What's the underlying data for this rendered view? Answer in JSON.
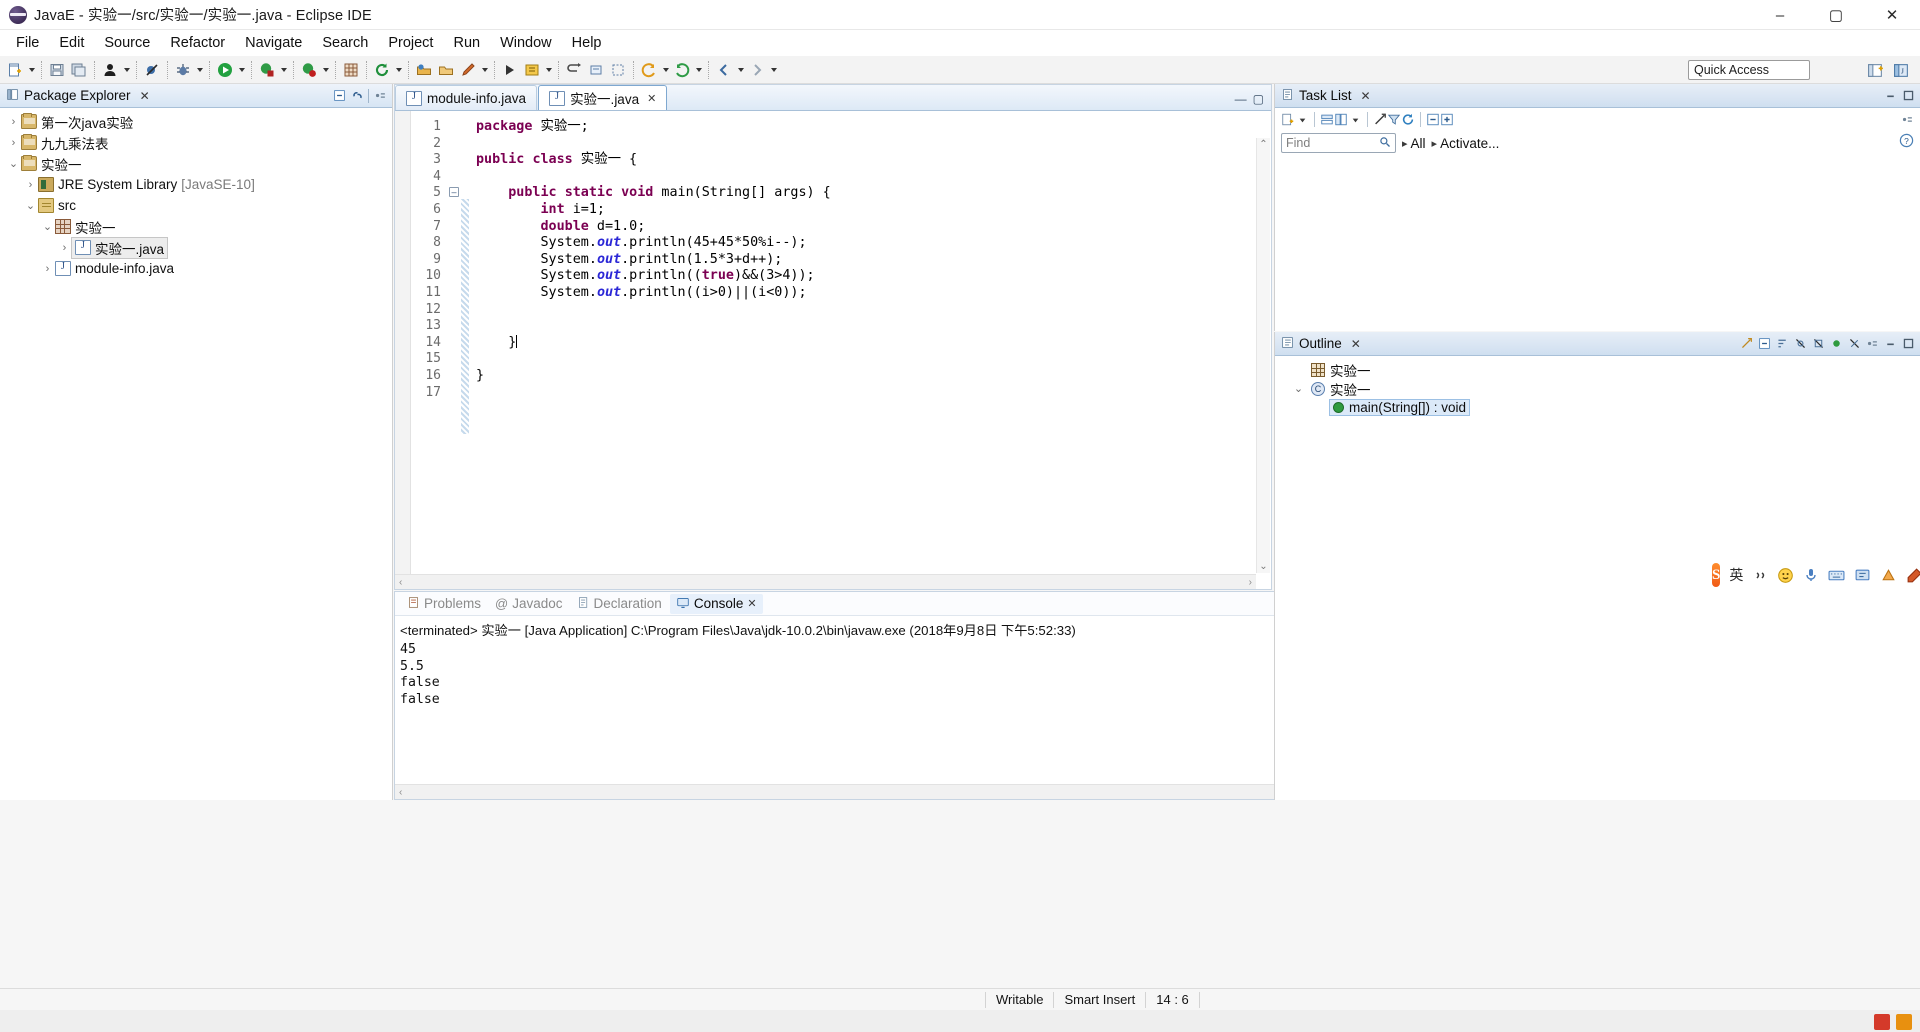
{
  "window": {
    "title": "JavaE - 实验一/src/实验一/实验一.java - Eclipse IDE",
    "app_icon": "eclipse-icon",
    "minimize": "–",
    "maximize": "▢",
    "close": "✕"
  },
  "menu": {
    "items": [
      {
        "label": "File"
      },
      {
        "label": "Edit"
      },
      {
        "label": "Source"
      },
      {
        "label": "Refactor"
      },
      {
        "label": "Navigate"
      },
      {
        "label": "Search"
      },
      {
        "label": "Project"
      },
      {
        "label": "Run"
      },
      {
        "label": "Window"
      },
      {
        "label": "Help"
      }
    ]
  },
  "toolbar": {
    "quick_access": "Quick Access",
    "buttons": [
      "new-button",
      "save-button",
      "save-all-button",
      "person-button",
      "skip-breakpoints-button",
      "debug-button",
      "run-button",
      "run-external-tools-button",
      "run-config-button",
      "new-package-button",
      "refresh-button",
      "open-type-button",
      "open-resource-button",
      "search-button",
      "last-edit-button",
      "back-button",
      "forward-button"
    ],
    "perspective_buttons": [
      "open-perspective-button",
      "java-perspective-button"
    ]
  },
  "package_explorer": {
    "title": "Package Explorer",
    "close_glyph": "✕",
    "tools": [
      "collapse-all-icon",
      "link-with-editor-icon",
      "view-menu-icon"
    ],
    "tree": [
      {
        "indent": 0,
        "twisty": "›",
        "icon": "project-icon",
        "label": "第一次java实验",
        "selected": false
      },
      {
        "indent": 0,
        "twisty": "›",
        "icon": "project-icon",
        "label": "九九乘法表",
        "selected": false
      },
      {
        "indent": 0,
        "twisty": "⌄",
        "icon": "project-icon",
        "label": "实验一",
        "selected": false
      },
      {
        "indent": 1,
        "twisty": "›",
        "icon": "library-icon",
        "label": "JRE System Library",
        "suffix": "[JavaSE-10]",
        "selected": false
      },
      {
        "indent": 1,
        "twisty": "⌄",
        "icon": "source-folder-icon",
        "label": "src",
        "selected": false
      },
      {
        "indent": 2,
        "twisty": "⌄",
        "icon": "package-icon",
        "label": "实验一",
        "selected": false
      },
      {
        "indent": 3,
        "twisty": "›",
        "icon": "java-file-icon",
        "label": "实验一.java",
        "selected": true
      },
      {
        "indent": 2,
        "twisty": "›",
        "icon": "java-file-icon",
        "label": "module-info.java",
        "selected": false
      }
    ]
  },
  "editor": {
    "tabs": [
      {
        "label": "module-info.java",
        "icon": "java-file-icon",
        "active": false,
        "closable": false
      },
      {
        "label": "实验一.java",
        "icon": "java-file-icon",
        "active": true,
        "closable": true,
        "close_glyph": "✕"
      }
    ],
    "minimize_glyph": "—",
    "maximize_glyph": "▢",
    "current_line": 14,
    "scroll_left_glyph": "‹",
    "scroll_right_glyph": "›",
    "scroll_up_glyph": "⌃",
    "scroll_down_glyph": "⌄",
    "lines": [
      {
        "n": 1,
        "fold": "",
        "text": "package 实验一;"
      },
      {
        "n": 2,
        "fold": "",
        "text": ""
      },
      {
        "n": 3,
        "fold": "",
        "text": "public class 实验一 {"
      },
      {
        "n": 4,
        "fold": "",
        "text": ""
      },
      {
        "n": 5,
        "fold": "⊖",
        "text": "    public static void main(String[] args) {"
      },
      {
        "n": 6,
        "fold": "",
        "text": "        int i=1;"
      },
      {
        "n": 7,
        "fold": "",
        "text": "        double d=1.0;"
      },
      {
        "n": 8,
        "fold": "",
        "text": "        System.out.println(45+45*50%i--);"
      },
      {
        "n": 9,
        "fold": "",
        "text": "        System.out.println(1.5*3+d++);"
      },
      {
        "n": 10,
        "fold": "",
        "text": "        System.out.println((true)&&(3>4));"
      },
      {
        "n": 11,
        "fold": "",
        "text": "        System.out.println((i>0)||(i<0));"
      },
      {
        "n": 12,
        "fold": "",
        "text": ""
      },
      {
        "n": 13,
        "fold": "",
        "text": ""
      },
      {
        "n": 14,
        "fold": "",
        "text": "    }"
      },
      {
        "n": 15,
        "fold": "",
        "text": ""
      },
      {
        "n": 16,
        "fold": "",
        "text": "}"
      },
      {
        "n": 17,
        "fold": "",
        "text": ""
      }
    ]
  },
  "console": {
    "tabs": [
      {
        "label": "Problems",
        "icon": "problems-icon",
        "active": false
      },
      {
        "label": "Javadoc",
        "icon": "javadoc-icon",
        "active": false
      },
      {
        "label": "Declaration",
        "icon": "declaration-icon",
        "active": false
      },
      {
        "label": "Console",
        "icon": "console-icon",
        "active": true,
        "close_glyph": "✕"
      }
    ],
    "header": "<terminated> 实验一 [Java Application] C:\\Program Files\\Java\\jdk-10.0.2\\bin\\javaw.exe (2018年9月8日 下午5:52:33)",
    "output": [
      "45",
      "5.5",
      "false",
      "false"
    ],
    "tools": [
      "terminate-icon",
      "remove-launch-icon",
      "remove-all-terminated-icon",
      "clear-console-icon",
      "scroll-lock-icon",
      "pin-console-icon",
      "show-console-icon",
      "display-selected-console-icon",
      "open-console-icon",
      "view-menu-icon",
      "minimize-icon",
      "maximize-icon"
    ],
    "scroll_left_glyph": "‹",
    "scroll_right_glyph": "›"
  },
  "task_list": {
    "title": "Task List",
    "close_glyph": "✕",
    "find_placeholder": "Find",
    "find_value": "",
    "all_label": "All",
    "activate_label": "Activate...",
    "all_arrow": "▸",
    "activate_arrow": "▸",
    "tools": [
      "new-task-icon",
      "categorize-icon",
      "presentation-icon",
      "focus-icon",
      "filter-icon",
      "synchronize-icon",
      "collapse-all-icon",
      "expand-all-icon",
      "view-menu-icon",
      "minimize-icon",
      "maximize-icon"
    ],
    "help_icon": "help-icon"
  },
  "outline": {
    "title": "Outline",
    "close_glyph": "✕",
    "tools": [
      "focus-icon",
      "collapse-all-icon",
      "sort-icon",
      "hide-fields-icon",
      "hide-static-icon",
      "hide-nonpublic-icon",
      "hide-local-icon",
      "view-menu-icon",
      "minimize-icon",
      "maximize-icon"
    ],
    "rows": [
      {
        "indent": 0,
        "twisty": "",
        "icon": "package-icon",
        "label": "实验一",
        "selected": false
      },
      {
        "indent": 0,
        "twisty": "⌄",
        "icon": "class-icon",
        "label": "实验一",
        "selected": false
      },
      {
        "indent": 1,
        "twisty": "",
        "icon": "method-icon",
        "label": "main(String[]) : void",
        "selected": true
      }
    ]
  },
  "ime": {
    "logo": "S",
    "mode": "英",
    "items": [
      "comma-icon",
      "smiley-icon",
      "mic-icon",
      "keyboard-icon",
      "tools-icon",
      "skin-icon",
      "settings-icon"
    ]
  },
  "status_bar": {
    "writable": "Writable",
    "insert_mode": "Smart Insert",
    "position": "14 : 6",
    "divider": ":"
  },
  "colors": {
    "keyword": "#7b0052",
    "field": "#2a26d6",
    "accent": "#3a7bd5",
    "tab_active": "#ffffff",
    "panel_head": "#cfdff0"
  }
}
